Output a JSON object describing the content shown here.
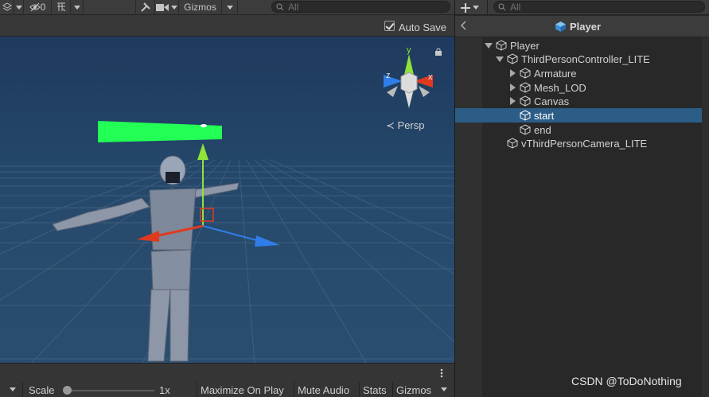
{
  "scene": {
    "toolbar": {
      "hidden_count": "0",
      "gizmos_label": "Gizmos",
      "search_placeholder": "All"
    },
    "auto_save": {
      "label": "Auto Save",
      "checked": true
    },
    "persp_label": "Persp",
    "gizmo_axes": {
      "x": "x",
      "y": "y",
      "z": "z"
    },
    "bottom_bar": {
      "scale_label": "Scale",
      "scale_value": "1x",
      "buttons": [
        "Maximize On Play",
        "Mute Audio",
        "Stats",
        "Gizmos"
      ]
    }
  },
  "hierarchy": {
    "search_placeholder": "All",
    "title": "Player",
    "items": [
      {
        "label": "Player",
        "expanded": true
      },
      {
        "label": "ThirdPersonController_LITE",
        "expanded": true
      },
      {
        "label": "Armature",
        "expanded": false
      },
      {
        "label": "Mesh_LOD",
        "expanded": false
      },
      {
        "label": "Canvas",
        "expanded": false
      },
      {
        "label": "start",
        "selected": true
      },
      {
        "label": "end"
      },
      {
        "label": "vThirdPersonCamera_LITE"
      }
    ]
  },
  "watermark": "CSDN @ToDoNothing",
  "colors": {
    "selection": "#2c5d87",
    "canvas_bar": "#22ff55",
    "axis_x": "#e03a1e",
    "axis_y": "#8fe339",
    "axis_z": "#2f7de8"
  }
}
